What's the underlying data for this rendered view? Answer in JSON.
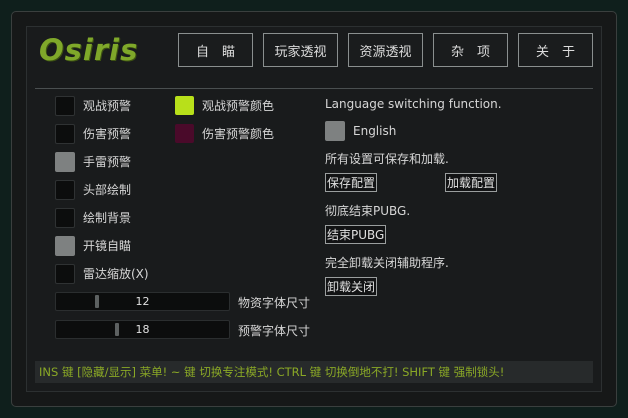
{
  "app": {
    "logo": "Osiris"
  },
  "nav": {
    "tabs": [
      {
        "label": "自　瞄"
      },
      {
        "label": "玩家透视"
      },
      {
        "label": "资源透视"
      },
      {
        "label": "杂　项"
      },
      {
        "label": "关　于"
      }
    ]
  },
  "left_checks": [
    {
      "label": "观战预警",
      "checked": false
    },
    {
      "label": "伤害预警",
      "checked": false
    },
    {
      "label": "手雷预警",
      "checked": true
    },
    {
      "label": "头部绘制",
      "checked": false
    },
    {
      "label": "绘制背景",
      "checked": false
    },
    {
      "label": "开镜自瞄",
      "checked": true
    },
    {
      "label": "雷达缩放(X)",
      "checked": false
    }
  ],
  "color_options": [
    {
      "label": "观战预警颜色",
      "color": "#b8e01a"
    },
    {
      "label": "伤害预警颜色",
      "color": "#4a0a2a"
    }
  ],
  "sliders": [
    {
      "value": "12",
      "label": "物资字体尺寸",
      "fraction": 0.22
    },
    {
      "value": "18",
      "label": "预警字体尺寸",
      "fraction": 0.34
    }
  ],
  "right": {
    "language_desc": "Language switching function.",
    "language_option": {
      "label": "English",
      "checked": true
    },
    "save_desc": "所有设置可保存和加载.",
    "save_button": "保存配置",
    "load_button": "加载配置",
    "end_desc": "彻底结束PUBG.",
    "end_button": "结束PUBG",
    "uninstall_desc": "完全卸载关闭辅助程序.",
    "uninstall_button": "卸载关闭"
  },
  "footer": {
    "hint": "INS 键 [隐藏/显示] 菜单! ~ 键 切换专注模式! CTRL 键 切换倒地不打! SHIFT 键 强制锁头!"
  },
  "colors": {
    "accent": "#7fa82a",
    "footer_text": "#8aa826",
    "checkbox_on": "#7e8181",
    "checkbox_off": "#0c0d0d"
  }
}
